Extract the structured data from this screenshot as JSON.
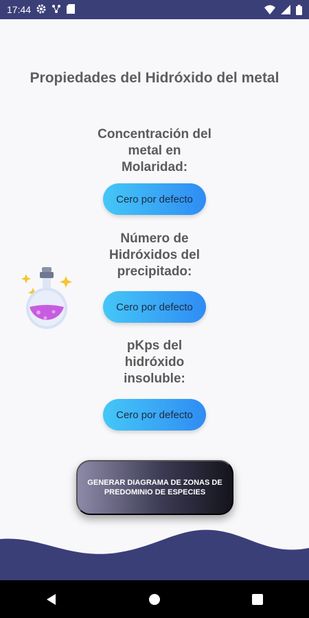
{
  "status_bar": {
    "time": "17:44",
    "icons_left": [
      "gear-icon",
      "network-icon",
      "sd-card-icon"
    ],
    "icons_right": [
      "wifi-icon",
      "signal-icon",
      "battery-icon"
    ]
  },
  "page": {
    "title": "Propiedades del Hidróxido del metal"
  },
  "fields": [
    {
      "label": "Concentración del metal en Molaridad:",
      "button": "Cero por defecto"
    },
    {
      "label": "Número de Hidróxidos del precipitado:",
      "button": "Cero por defecto"
    },
    {
      "label": "pKps del hidróxido insoluble:",
      "button": "Cero por defecto"
    }
  ],
  "generate_button": {
    "label": "GENERAR DIAGRAMA DE ZONAS DE PREDOMINIO DE ESPECIES"
  },
  "colors": {
    "status_bar": "#3b3f78",
    "pill_start": "#45c7f7",
    "pill_end": "#2f8cf3",
    "wave": "#3b3f78",
    "potion_liquid": "#c65de0"
  },
  "nav_bar": {
    "icons": [
      "back-icon",
      "home-icon",
      "recents-icon"
    ]
  }
}
